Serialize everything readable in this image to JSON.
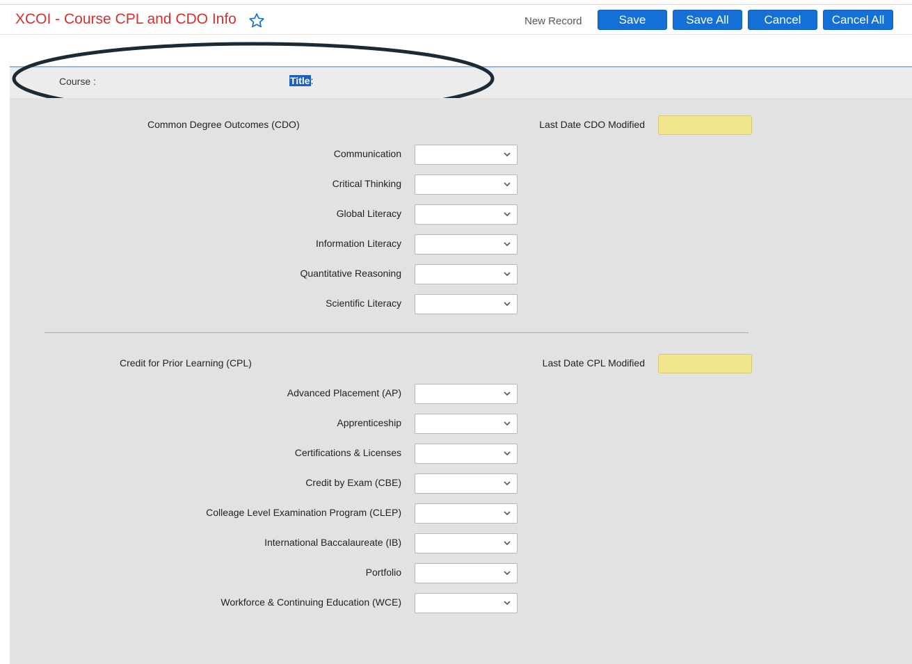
{
  "header": {
    "title": "XCOI - Course CPL and CDO Info",
    "new_record": "New Record",
    "buttons": {
      "save": "Save",
      "save_all": "Save All",
      "cancel": "Cancel",
      "cancel_all": "Cancel All"
    }
  },
  "course": {
    "course_label": "Course :",
    "title_label_highlighted": "Title",
    "title_label_colon": ":"
  },
  "cdo": {
    "heading": "Common Degree Outcomes (CDO)",
    "modified_label": "Last Date CDO Modified",
    "modified_value": "",
    "fields": [
      {
        "label": "Communication",
        "value": ""
      },
      {
        "label": "Critical Thinking",
        "value": ""
      },
      {
        "label": "Global Literacy",
        "value": ""
      },
      {
        "label": "Information Literacy",
        "value": ""
      },
      {
        "label": "Quantitative Reasoning",
        "value": ""
      },
      {
        "label": "Scientific Literacy",
        "value": ""
      }
    ]
  },
  "cpl": {
    "heading": "Credit for Prior Learning (CPL)",
    "modified_label": "Last Date CPL Modified",
    "modified_value": "",
    "fields": [
      {
        "label": "Advanced Placement (AP)",
        "value": ""
      },
      {
        "label": "Apprenticeship",
        "value": ""
      },
      {
        "label": "Certifications & Licenses",
        "value": ""
      },
      {
        "label": "Credit by Exam (CBE)",
        "value": ""
      },
      {
        "label": "Colleage Level Examination Program (CLEP)",
        "value": ""
      },
      {
        "label": "International Baccalaureate (IB)",
        "value": ""
      },
      {
        "label": "Portfolio",
        "value": ""
      },
      {
        "label": "Workforce & Continuing Education (WCE)",
        "value": ""
      }
    ]
  },
  "colors": {
    "title_red": "#d5302c",
    "button_blue": "#1470d6",
    "date_field_yellow": "#f1e68c",
    "form_background": "#e2e2e2"
  },
  "icons": {
    "favorite": "star-outline-icon",
    "dropdown": "chevron-down-icon",
    "annotation": "ellipse-annotation"
  }
}
